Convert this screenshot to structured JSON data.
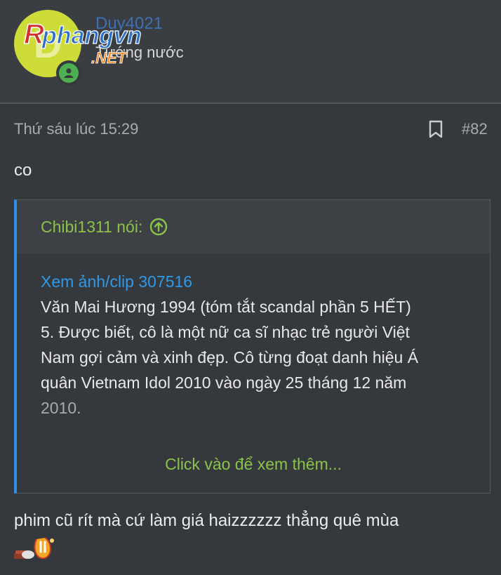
{
  "header": {
    "avatar_letter": "D",
    "username": "Duy4021",
    "user_title": "Tướng nước",
    "logo": {
      "text_main": "Rphangvn",
      "text_sub": ".NET"
    }
  },
  "post": {
    "date": "Thứ sáu lúc 15:29",
    "number": "#82",
    "first_line": "co",
    "quote": {
      "author": "Chibi1311 nói:",
      "link": "Xem ảnh/clip 307516",
      "lines": [
        "Văn Mai Hương 1994 (tóm tắt scandal phần 5 HẾT)",
        "5. Được biết, cô là một nữ ca sĩ nhạc trẻ người Việt",
        "Nam gợi cảm và xinh đẹp. Cô từng đoạt danh hiệu Á",
        "quân Vietnam Idol 2010 vào ngày 25 tháng 12 năm",
        "2010."
      ],
      "expand_label": "Click vào để xem thêm..."
    },
    "reply": "phim cũ rít mà cứ làm giá haizzzzzz thẳng quê mùa"
  },
  "colors": {
    "accent_green": "#8bc34a",
    "link_blue": "#2f9ae8",
    "avatar_bg": "#cddc39",
    "online": "#4caf50"
  },
  "icons": [
    "bookmark-icon",
    "arrow-up-circle-icon",
    "online-status-icon",
    "emoji-sticker-icon"
  ]
}
